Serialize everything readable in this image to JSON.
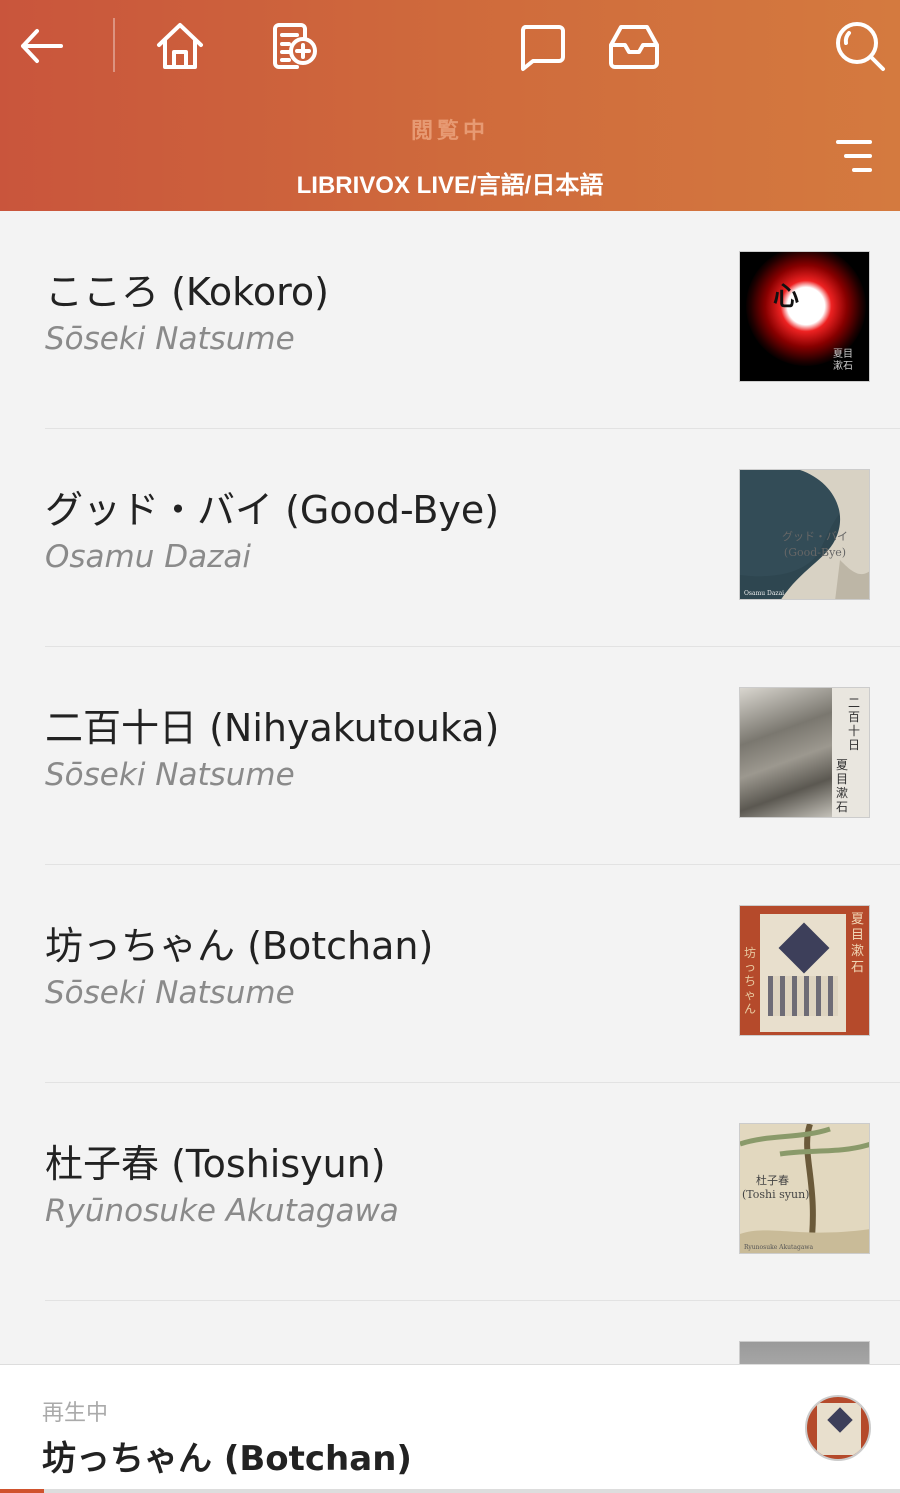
{
  "header": {
    "browsing_label": "閲覧中",
    "path": "LIBRIVOX LIVE/言語/日本語",
    "icons": [
      "back-arrow-icon",
      "home-icon",
      "add-document-icon",
      "chat-icon",
      "inbox-icon",
      "search-icon",
      "menu-icon"
    ]
  },
  "books": [
    {
      "title": "こころ (Kokoro)",
      "author": "Sōseki Natsume",
      "cover_text": "心",
      "cover_sub": "夏目漱石"
    },
    {
      "title": "グッド・バイ (Good-Bye)",
      "author": "Osamu Dazai",
      "cover_text": "グッド・バイ",
      "cover_sub": "(Good-Bye)",
      "cover_foot": "Osamu Dazai"
    },
    {
      "title": "二百十日 (Nihyakutouka)",
      "author": "Sōseki Natsume",
      "cover_text": "二百十日",
      "cover_sub": "夏目漱石"
    },
    {
      "title": "坊っちゃん (Botchan)",
      "author": "Sōseki Natsume",
      "cover_text": "坊っちゃん",
      "cover_sub": "夏目漱石"
    },
    {
      "title": "杜子春 (Toshisyun)",
      "author": "Ryūnosuke Akutagawa",
      "cover_text": "杜子春",
      "cover_sub": "(Toshi syun)",
      "cover_foot": "Ryunosuke Akutagawa"
    }
  ],
  "player": {
    "status": "再生中",
    "title": "坊っちゃん (Botchan)",
    "progress": 0.05
  },
  "colors": {
    "header_start": "#c9553c",
    "header_end": "#d47a3f",
    "accent": "#d0532e"
  }
}
